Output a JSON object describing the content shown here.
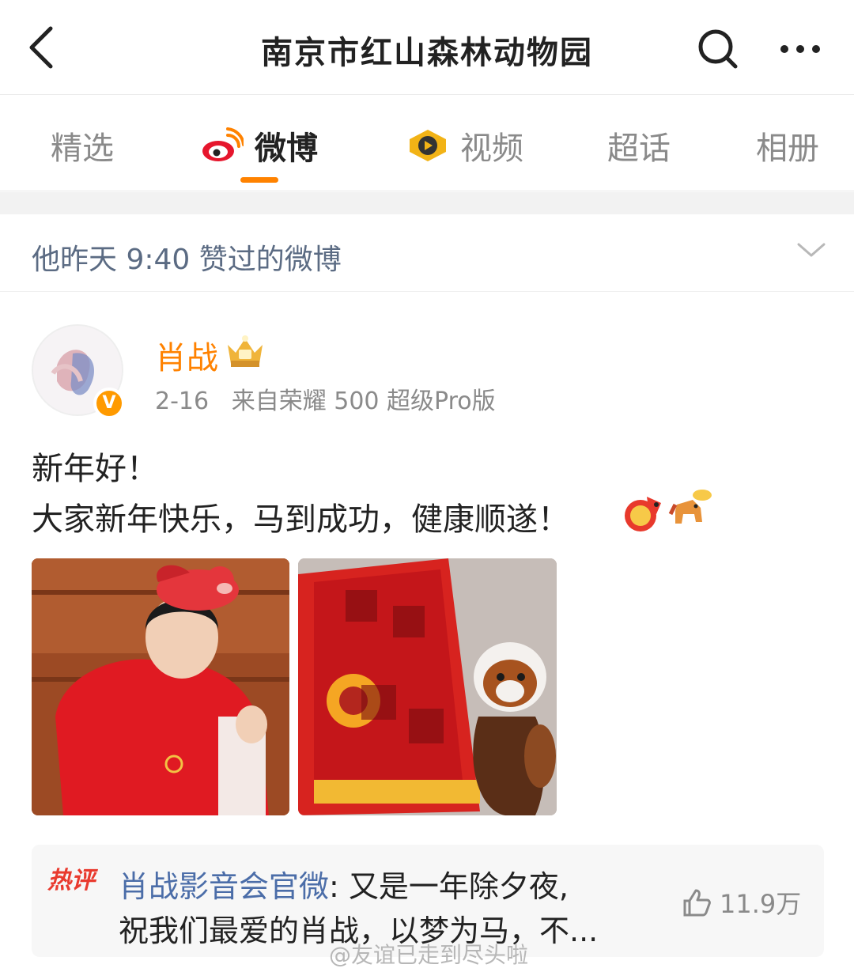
{
  "header": {
    "title": "南京市红山森林动物园",
    "back_icon": "chevron-left-icon",
    "search_icon": "search-icon",
    "more_icon": "more-dots-icon"
  },
  "tabs": [
    {
      "label": "精选",
      "active": false
    },
    {
      "label": "微博",
      "active": true,
      "icon": "weibo-icon"
    },
    {
      "label": "视频",
      "active": false,
      "icon": "video-icon"
    },
    {
      "label": "超话",
      "active": false
    },
    {
      "label": "相册",
      "active": false
    }
  ],
  "liked_bar": {
    "text": "他昨天 9:40 赞过的微博",
    "icon": "chevron-down-icon"
  },
  "post": {
    "author": "肖战",
    "verified_badge": "V",
    "date": "2-16",
    "source_prefix": "来自",
    "source": "荣耀 500 超级Pro版",
    "line1": "新年好！",
    "line2": "大家新年快乐，马到成功，健康顺遂！"
  },
  "hot_comment": {
    "tag": "热评",
    "author": "肖战影音会官微",
    "line1_text": ": 又是一年除夕夜,",
    "line2_text": "祝我们最爱的肖战，以梦为马，不...",
    "likes": "11.9万"
  },
  "watermark": "@友谊已走到尽头啦",
  "colors": {
    "accent": "#ff8200",
    "link": "#4b6da8",
    "hot": "#e93a2e"
  }
}
